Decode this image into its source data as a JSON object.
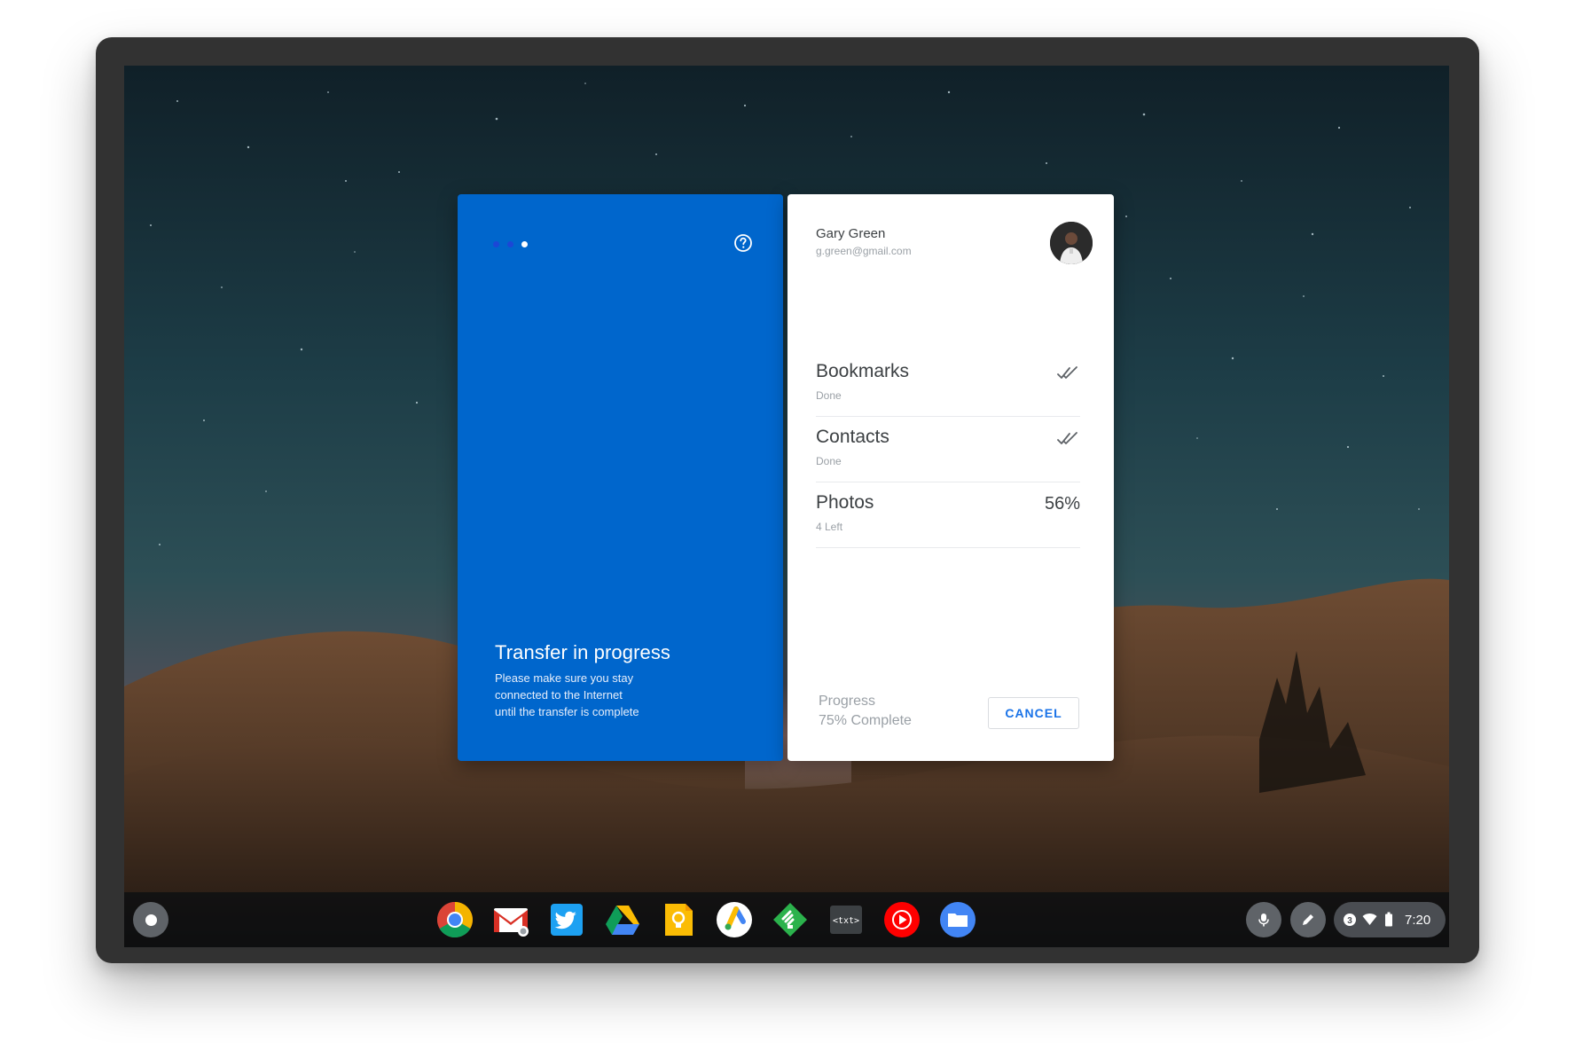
{
  "transfer": {
    "title": "Transfer in progress",
    "message_lines": [
      "Please make sure you stay",
      "connected to the Internet",
      "until the transfer is complete"
    ]
  },
  "account": {
    "name": "Gary Green",
    "email": "g.green@gmail.com"
  },
  "sync_items": [
    {
      "label": "Bookmarks",
      "status": "Done",
      "state": "done"
    },
    {
      "label": "Contacts",
      "status": "Done",
      "state": "done"
    },
    {
      "label": "Photos",
      "status": "4 Left",
      "percent": "56%",
      "state": "in-progress"
    }
  ],
  "progress": {
    "label": "Progress",
    "value_text": "75% Complete"
  },
  "cancel_label": "CANCEL",
  "shelf": {
    "apps": [
      "chrome",
      "gmail",
      "twitter",
      "google-drive",
      "google-keep",
      "google-ads",
      "feedly",
      "text-editor",
      "youtube-music",
      "files"
    ],
    "text_app_label": "<txt>",
    "notification_count": "3",
    "time": "7:20"
  },
  "colors": {
    "transfer_card": "#0066cc",
    "accent": "#1a73e8"
  }
}
